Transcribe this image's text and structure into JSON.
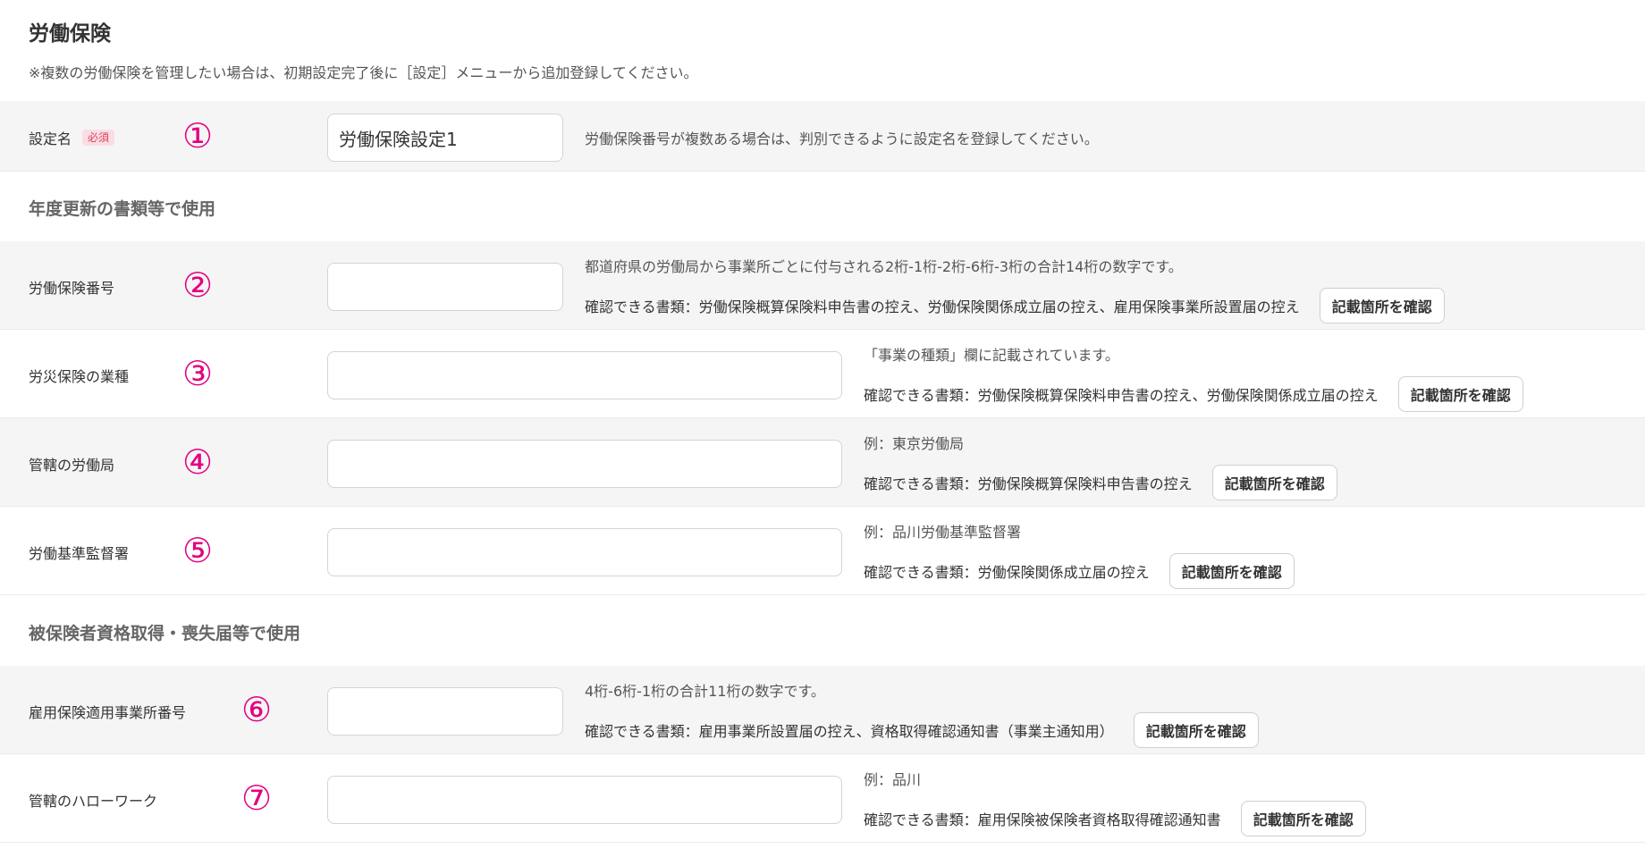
{
  "header": {
    "title": "労働保険",
    "note": "※複数の労働保険を管理したい場合は、初期設定完了後に［設定］メニューから追加登録してください。"
  },
  "sections": {
    "annual": "年度更新の書類等で使用",
    "insured": "被保険者資格取得・喪失届等で使用"
  },
  "rows": [
    {
      "label": "設定名",
      "required": "必須",
      "marker": "①",
      "value": "労働保険設定1",
      "help": "労働保険番号が複数ある場合は、判別できるように設定名を登録してください。"
    },
    {
      "label": "労働保険番号",
      "marker": "②",
      "value": "",
      "help": "都道府県の労働局から事業所ごとに付与される2桁-1桁-2桁-6桁-3桁の合計14桁の数字です。",
      "docs": "確認できる書類：労働保険概算保険料申告書の控え、労働保険関係成立届の控え、雇用保険事業所設置届の控え",
      "button": "記載箇所を確認"
    },
    {
      "label": "労災保険の業種",
      "marker": "③",
      "value": "",
      "help": "「事業の種類」欄に記載されています。",
      "docs": "確認できる書類：労働保険概算保険料申告書の控え、労働保険関係成立届の控え",
      "button": "記載箇所を確認"
    },
    {
      "label": "管轄の労働局",
      "marker": "④",
      "value": "",
      "help": "例：東京労働局",
      "docs": "確認できる書類：労働保険概算保険料申告書の控え",
      "button": "記載箇所を確認"
    },
    {
      "label": "労働基準監督署",
      "marker": "⑤",
      "value": "",
      "help": "例：品川労働基準監督署",
      "docs": "確認できる書類：労働保険関係成立届の控え",
      "button": "記載箇所を確認"
    },
    {
      "label": "雇用保険適用事業所番号",
      "marker": "⑥",
      "value": "",
      "help": "4桁-6桁-1桁の合計11桁の数字です。",
      "docs": "確認できる書類：雇用事業所設置届の控え、資格取得確認通知書（事業主通知用）",
      "button": "記載箇所を確認"
    },
    {
      "label": "管轄のハローワーク",
      "marker": "⑦",
      "value": "",
      "help": "例：品川",
      "docs": "確認できる書類：雇用保険被保険者資格取得確認通知書",
      "button": "記載箇所を確認"
    }
  ],
  "colors": {
    "marker": "#e3007f",
    "required_bg": "#fbdde3",
    "required_text": "#d8425f",
    "row_gray": "#f5f5f6"
  }
}
